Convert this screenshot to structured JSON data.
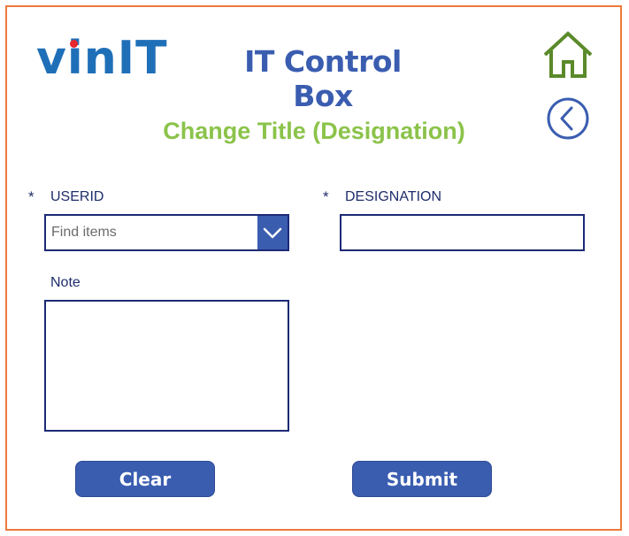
{
  "header": {
    "logo_text": "vinIT",
    "app_title": "IT Control Box",
    "page_subtitle": "Change Title (Designation)"
  },
  "nav": {
    "home_icon": "home-icon",
    "back_icon": "back-icon"
  },
  "form": {
    "required_marker": "*",
    "userid": {
      "label": "USERID",
      "placeholder": "Find items",
      "value": ""
    },
    "designation": {
      "label": "DESIGNATION",
      "value": ""
    },
    "note": {
      "label": "Note",
      "value": ""
    }
  },
  "actions": {
    "clear_label": "Clear",
    "submit_label": "Submit"
  },
  "colors": {
    "frame_border": "#ee7a3b",
    "title": "#3a5db0",
    "subtitle": "#8bc34a",
    "button": "#3a5db0",
    "field_border": "#1c2a75",
    "home_icon": "#5b8a2a"
  }
}
